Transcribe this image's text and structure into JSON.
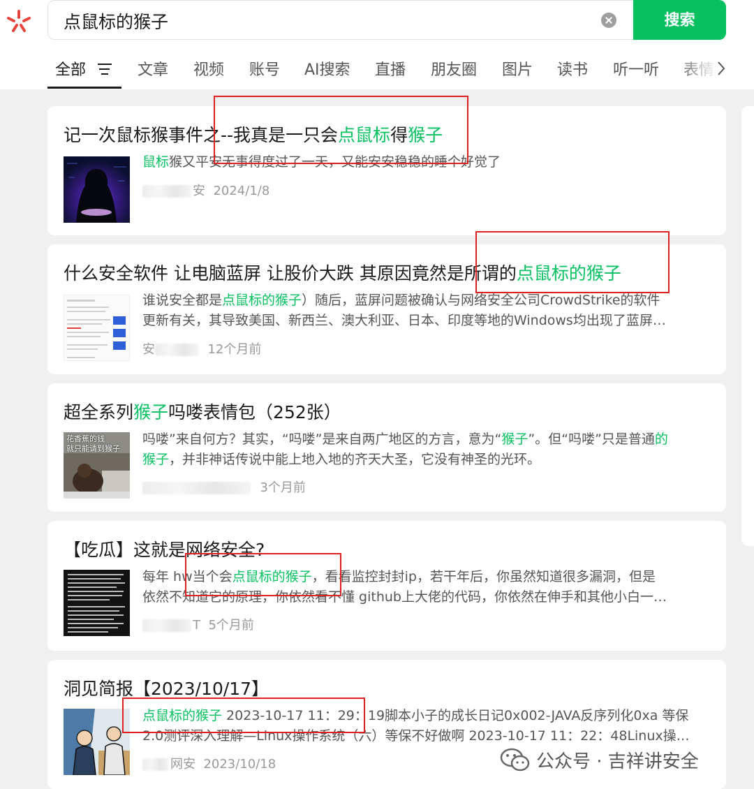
{
  "search": {
    "query": "点鼠标的猴子",
    "button_label": "搜索"
  },
  "tabs": [
    {
      "label": "全部"
    },
    {
      "label": "文章"
    },
    {
      "label": "视频"
    },
    {
      "label": "账号"
    },
    {
      "label": "AI搜索"
    },
    {
      "label": "直播"
    },
    {
      "label": "朋友圈"
    },
    {
      "label": "图片"
    },
    {
      "label": "读书"
    },
    {
      "label": "听一听"
    },
    {
      "label": "表情"
    }
  ],
  "results": [
    {
      "title": [
        "记一次鼠标猴事件之--我真是一只会",
        "点鼠标",
        "得",
        "猴子",
        ""
      ],
      "snippet_lines": [
        [
          "",
          "鼠标",
          "猴又平安无事得度过了一天，又能安安稳稳的睡个好觉了"
        ]
      ],
      "source_visible": "安",
      "time": "2024/1/8"
    },
    {
      "title": [
        "什么安全软件 让电脑蓝屏 让股价大跌 其原因竟然是所谓的",
        "点鼠标的猴子",
        ""
      ],
      "snippet_lines": [
        [
          "谁说安全都是",
          "点鼠标的猴子",
          "）随后，蓝屏问题被确认与网络安全公司CrowdStrike的软件"
        ],
        [
          "更新有关，其导致美国、新西兰、澳大利亚、日本、印度等地的Windows均出现了蓝屏…",
          "",
          ""
        ]
      ],
      "source_visible": "安",
      "time": "12个月前"
    },
    {
      "title": [
        "超全系列",
        "猴子",
        "吗喽表情包（252张）"
      ],
      "snippet_lines": [
        [
          "吗喽”来自何方？其实，“吗喽”是来自两广地区的方言，意为“",
          "猴子",
          "”。但“吗喽”只是普通",
          "的"
        ],
        [
          "",
          "猴子",
          "，并非神话传说中能上地入地的齐天大圣，它没有神圣的光环。"
        ]
      ],
      "source_visible": "",
      "time": "3个月前",
      "thumb_text": [
        "花香蕉的钱",
        "就只能请到猴子"
      ]
    },
    {
      "title": [
        "【吃瓜】这就是网络安全?",
        "",
        ""
      ],
      "snippet_lines": [
        [
          "每年 hw当个会",
          "点鼠标的猴子",
          "，看看监控封封ip，若干年后，你虽然知道很多漏洞，但是"
        ],
        [
          "依然不知道它的原理，你依然看不懂 github上大佬的代码，你依然在伸手和其他小白一…",
          "",
          ""
        ]
      ],
      "source_visible": "T",
      "time": "5个月前"
    },
    {
      "title": [
        "洞见简报【2023/10/17】",
        "",
        ""
      ],
      "snippet_lines": [
        [
          "",
          "点鼠标的猴子",
          " 2023-10-17 11：29：19脚本小子的成长日记0x002-JAVA反序列化0xa 等保"
        ],
        [
          "2.0测评深入理解—Linux操作系统（六）等保不好做啊 2023-10-17 11：22：48Linux操…",
          "",
          ""
        ]
      ],
      "source_visible": "网安",
      "time": "2023/10/18"
    }
  ],
  "watermark": "公众号 · 吉祥讲安全",
  "colors": {
    "brand_green": "#07c160",
    "annotation_red": "#e02020"
  }
}
